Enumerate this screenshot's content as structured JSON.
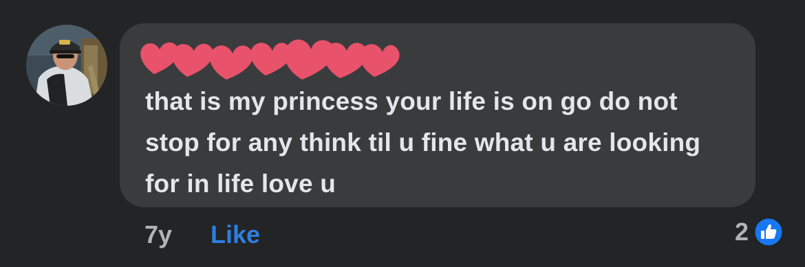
{
  "comment": {
    "text": "that is my princess your life is on go do not stop for any think til u fine what u are looking for in life love u",
    "time": "7y",
    "like_label": "Like",
    "reaction_count": "2",
    "reaction_icon": "thumbs-up-icon"
  },
  "colors": {
    "background": "#232425",
    "bubble": "#3a3b3c",
    "text": "#e4e6eb",
    "muted": "#b0b3b8",
    "link": "#2d7fe0",
    "redaction": "#e8526a"
  }
}
